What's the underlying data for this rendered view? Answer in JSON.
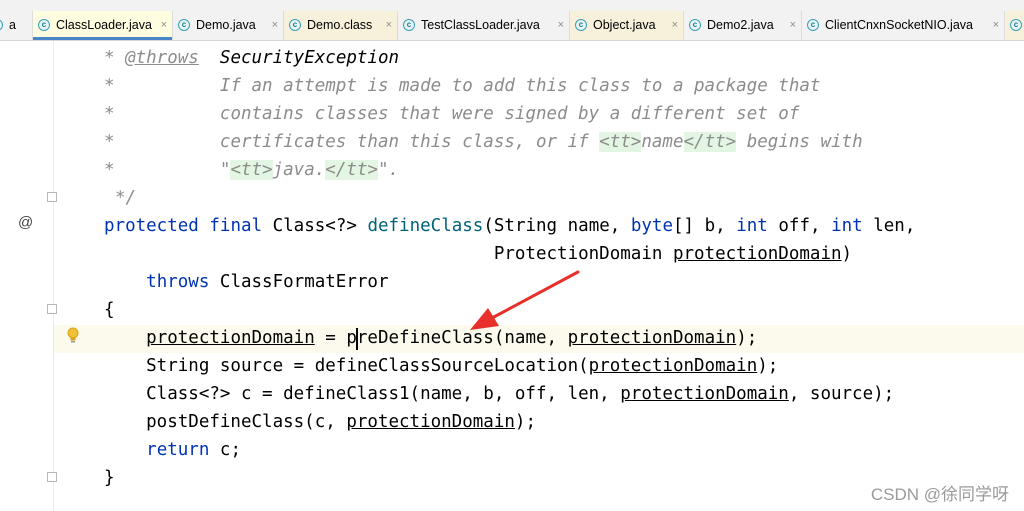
{
  "tabs": [
    {
      "label": "a",
      "type": "java",
      "closable": false
    },
    {
      "label": "ClassLoader.java",
      "type": "java",
      "active": true
    },
    {
      "label": "Demo.java",
      "type": "java"
    },
    {
      "label": "Demo.class",
      "type": "class"
    },
    {
      "label": "TestClassLoader.java",
      "type": "java"
    },
    {
      "label": "Object.java",
      "type": "java"
    },
    {
      "label": "Demo2.java",
      "type": "java"
    },
    {
      "label": "ClientCnxnSocketNIO.java",
      "type": "java"
    }
  ],
  "tab_icon_letter": "c",
  "tab_close_glyph": "×",
  "gutter": {
    "override_marker": "@"
  },
  "code": {
    "l1": {
      "star": "* ",
      "tag": "@throws",
      "sp": "  ",
      "exc": "SecurityException"
    },
    "l2": {
      "star": "*",
      "text": "          If an attempt is made to add this class to a package that"
    },
    "l3": {
      "star": "*",
      "text": "          contains classes that were signed by a different set of"
    },
    "l4": {
      "star": "*",
      "pre": "          certificates than this class, or if ",
      "tt_open": "<tt>",
      "name": "name",
      "tt_close": "</tt>",
      "post": " begins with"
    },
    "l5": {
      "star": "*",
      "pre": "          \"",
      "tt_open": "<tt>",
      "java": "java.",
      "tt_close": "</tt>",
      "post": "\"."
    },
    "l6": {
      "end": "*/"
    },
    "l7": {
      "protected": "protected",
      "final": "final",
      "cls": "Class<?> ",
      "method": "defineClass",
      "params1": "(String name, ",
      "byte": "byte",
      "params2": "[] b, ",
      "int1": "int",
      "off": " off, ",
      "int2": "int",
      "len": " len,"
    },
    "l8": {
      "indent": "                                     ",
      "pd_type": "ProtectionDomain ",
      "pd": "protectionDomain",
      "close": ")"
    },
    "l9": {
      "indent": "    ",
      "throws": "throws",
      "exc": " ClassFormatError"
    },
    "l10": {
      "text": "{"
    },
    "l11": {
      "indent": "    ",
      "pd": "protectionDomain",
      "assign": " = ",
      "call": "preDefineClass",
      "args1": "(name, ",
      "pd2": "protectionDomain",
      "args2": ");"
    },
    "l12": {
      "text": "    String source = defineClassSourceLocation(",
      "pd": "protectionDomain",
      "end": ");"
    },
    "l13": {
      "text": "    Class<?> c = defineClass1(name, b, off, len, ",
      "pd": "protectionDomain",
      "end": ", source);"
    },
    "l14": {
      "text": "    postDefineClass(c, ",
      "pd": "protectionDomain",
      "end": ");"
    },
    "l15": {
      "indent": "    ",
      "ret": "return",
      "rest": " c;"
    },
    "l16": {
      "text": "}"
    }
  },
  "colors": {
    "keyword": "#0033b3",
    "method": "#00627a",
    "comment": "#8c8c8c",
    "arrow": "#e8302a",
    "tt_highlight": "#e3f6e3",
    "current_line": "#fcfaed"
  },
  "watermark": "CSDN @徐同学呀"
}
